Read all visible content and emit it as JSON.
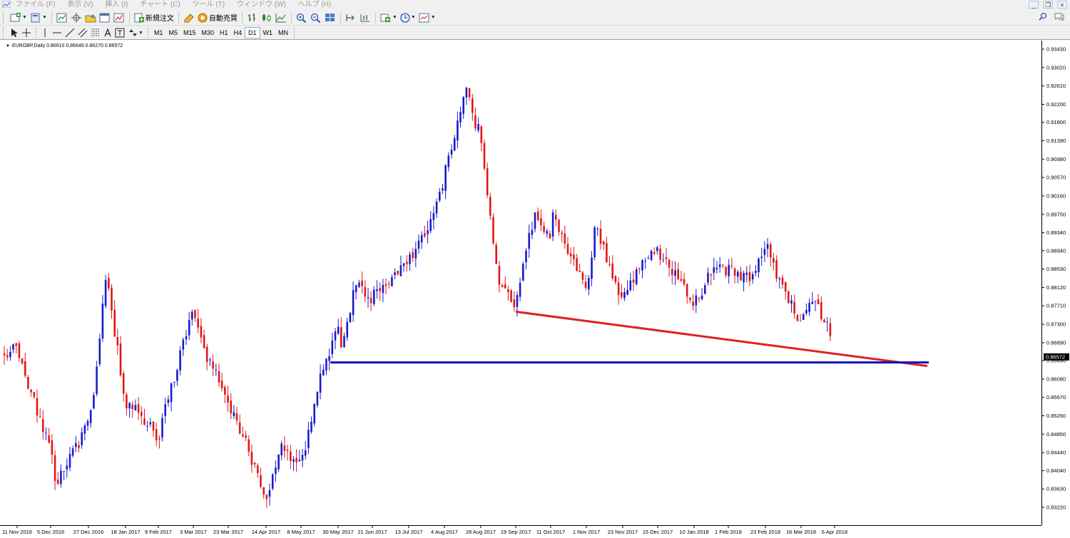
{
  "menu": {
    "items": [
      "ファイル (F)",
      "表示 (V)",
      "挿入 (I)",
      "チャート (C)",
      "ツール (T)",
      "ウィンドウ (W)",
      "ヘルプ (H)"
    ],
    "window_controls": [
      "_",
      "❐",
      "×"
    ]
  },
  "toolbar": {
    "new_order_label": "新規注文",
    "auto_trade_label": "自動売買",
    "timeframes": [
      "M1",
      "M5",
      "M15",
      "M30",
      "H1",
      "H4",
      "D1",
      "W1",
      "MN"
    ],
    "active_timeframe": "D1"
  },
  "chart_header": {
    "symbol": "EURGBP,Daily",
    "ohlc": "0.86610 0.86649 0.86270 0.86572"
  },
  "chart_data": {
    "type": "candlestick",
    "symbol": "EURGBP",
    "timeframe": "Daily",
    "ylim": [
      0.8215,
      0.9355
    ],
    "y_ticks": [
      "0.93430",
      "0.93020",
      "0.92610",
      "0.92200",
      "0.91800",
      "0.91390",
      "0.90980",
      "0.90570",
      "0.90160",
      "0.89750",
      "0.89340",
      "0.88940",
      "0.88530",
      "0.88120",
      "0.87710",
      "0.87300",
      "0.86890",
      "0.86490",
      "0.86080",
      "0.85670",
      "0.85260",
      "0.84850",
      "0.84440",
      "0.84040",
      "0.83630",
      "0.83220"
    ],
    "x_ticks": [
      "11 Nov 2016",
      "5 Dec 2016",
      "27 Dec 2016",
      "18 Jan 2017",
      "9 Feb 2017",
      "3 Mar 2017",
      "23 Mar 2017",
      "14 Apr 2017",
      "8 May 2017",
      "30 May 2017",
      "21 Jun 2017",
      "13 Jul 2017",
      "4 Aug 2017",
      "28 Aug 2017",
      "19 Sep 2017",
      "11 Oct 2017",
      "1 Nov 2017",
      "23 Nov 2017",
      "15 Dec 2017",
      "10 Jan 2018",
      "1 Feb 2018",
      "23 Feb 2018",
      "16 Mar 2018",
      "6 Apr 2018"
    ],
    "current_price": "0.86572",
    "up_color": "#1a1acc",
    "down_color": "#e01818",
    "path": [
      [
        "11 Nov 2016",
        0.867
      ],
      [
        "5 Dec 2016",
        0.845
      ],
      [
        "15 Dec 2016",
        0.837
      ],
      [
        "27 Dec 2016",
        0.851
      ],
      [
        "10 Jan 2017",
        0.865
      ],
      [
        "12 Jan 2017",
        0.884
      ],
      [
        "18 Jan 2017",
        0.856
      ],
      [
        "9 Feb 2017",
        0.848
      ],
      [
        "3 Mar 2017",
        0.877
      ],
      [
        "13 Mar 2017",
        0.866
      ],
      [
        "23 Mar 2017",
        0.856
      ],
      [
        "14 Apr 2017",
        0.835
      ],
      [
        "25 Apr 2017",
        0.846
      ],
      [
        "8 May 2017",
        0.841
      ],
      [
        "19 May 2017",
        0.86
      ],
      [
        "30 May 2017",
        0.872
      ],
      [
        "2 Jun 2017",
        0.867
      ],
      [
        "12 Jun 2017",
        0.882
      ],
      [
        "21 Jun 2017",
        0.879
      ],
      [
        "13 Jul 2017",
        0.887
      ],
      [
        "24 Jul 2017",
        0.893
      ],
      [
        "4 Aug 2017",
        0.906
      ],
      [
        "14 Aug 2017",
        0.926
      ],
      [
        "22 Aug 2017",
        0.919
      ],
      [
        "28 Aug 2017",
        0.915
      ],
      [
        "7 Sep 2017",
        0.881
      ],
      [
        "19 Sep 2017",
        0.877
      ],
      [
        "28 Sep 2017",
        0.897
      ],
      [
        "11 Oct 2017",
        0.893
      ],
      [
        "16 Oct 2017",
        0.898
      ],
      [
        "1 Nov 2017",
        0.88
      ],
      [
        "8 Nov 2017",
        0.895
      ],
      [
        "23 Nov 2017",
        0.878
      ],
      [
        "4 Dec 2017",
        0.887
      ],
      [
        "15 Dec 2017",
        0.889
      ],
      [
        "28 Dec 2017",
        0.884
      ],
      [
        "10 Jan 2018",
        0.877
      ],
      [
        "22 Jan 2018",
        0.886
      ],
      [
        "1 Feb 2018",
        0.885
      ],
      [
        "14 Feb 2018",
        0.883
      ],
      [
        "23 Feb 2018",
        0.891
      ],
      [
        "7 Mar 2018",
        0.882
      ],
      [
        "16 Mar 2018",
        0.873
      ],
      [
        "26 Mar 2018",
        0.878
      ],
      [
        "6 Apr 2018",
        0.87
      ],
      [
        "13 Apr 2018",
        0.866
      ]
    ],
    "annotations": [
      {
        "type": "trendline",
        "color": "#e02020",
        "from": [
          "19 Sep 2017",
          0.8758
        ],
        "to": [
          "after 6 Apr 2018",
          0.8637
        ]
      },
      {
        "type": "horizontal-line",
        "color": "#1111bb",
        "value": 0.8645,
        "from": "30 May 2017"
      }
    ]
  }
}
